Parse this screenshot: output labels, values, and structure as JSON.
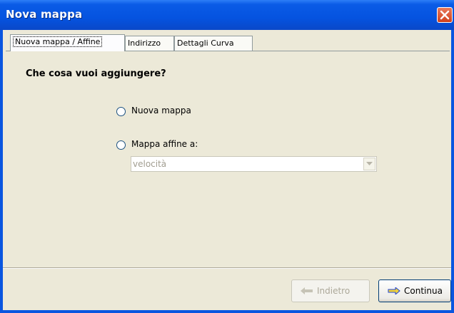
{
  "window": {
    "title": "Nova mappa",
    "close_icon": "close-icon"
  },
  "tabs": [
    {
      "label": "Nuova mappa / Affine",
      "active": true
    },
    {
      "label": "Indirizzo",
      "active": false
    },
    {
      "label": "Dettagli Curva",
      "active": false
    }
  ],
  "form": {
    "question": "Che cosa vuoi aggiungere?",
    "options": [
      {
        "label": "Nuova mappa",
        "selected": false
      },
      {
        "label": "Mappa affine a:",
        "selected": false
      }
    ],
    "affine_select": {
      "value": "velocità",
      "enabled": false
    }
  },
  "buttons": {
    "back": {
      "label": "Indietro",
      "enabled": false,
      "icon": "arrow-left-icon"
    },
    "next": {
      "label": "Continua",
      "enabled": true,
      "icon": "arrow-right-icon"
    }
  },
  "colors": {
    "titlebar": "#0553e0",
    "close": "#d1401b",
    "client": "#ece9d8",
    "arrow": "#1f44d8"
  }
}
